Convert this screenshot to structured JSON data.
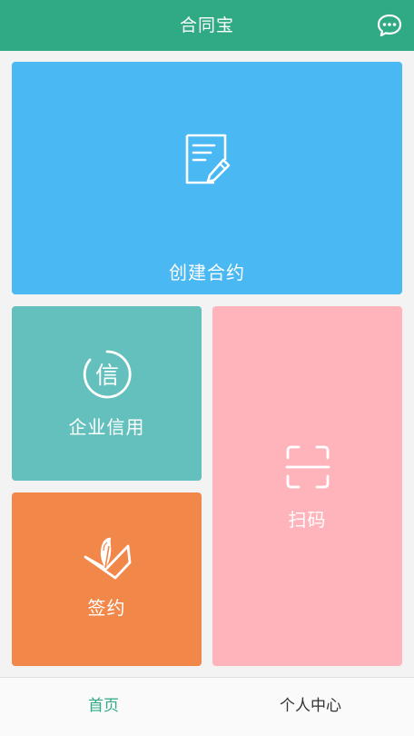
{
  "app": {
    "title": "合同宝"
  },
  "colors": {
    "header": "#2faa85",
    "create_tile": "#4ab8f3",
    "credit_tile": "#63c0bd",
    "sign_tile": "#f2874a",
    "scan_tile": "#ffb3ba",
    "tab_active": "#2faa85",
    "tab_inactive": "#333333"
  },
  "icons": {
    "header_action": "chat-bubble-icon",
    "create": "document-edit-icon",
    "credit": "credit-seal-icon",
    "sign": "quill-sign-icon",
    "scan": "scan-frame-icon"
  },
  "tiles": {
    "create": {
      "label": "创建合约"
    },
    "credit": {
      "label": "企业信用",
      "icon_text": "信"
    },
    "sign": {
      "label": "签约"
    },
    "scan": {
      "label": "扫码"
    }
  },
  "tabs": [
    {
      "label": "首页",
      "active": true
    },
    {
      "label": "个人中心",
      "active": false
    }
  ]
}
